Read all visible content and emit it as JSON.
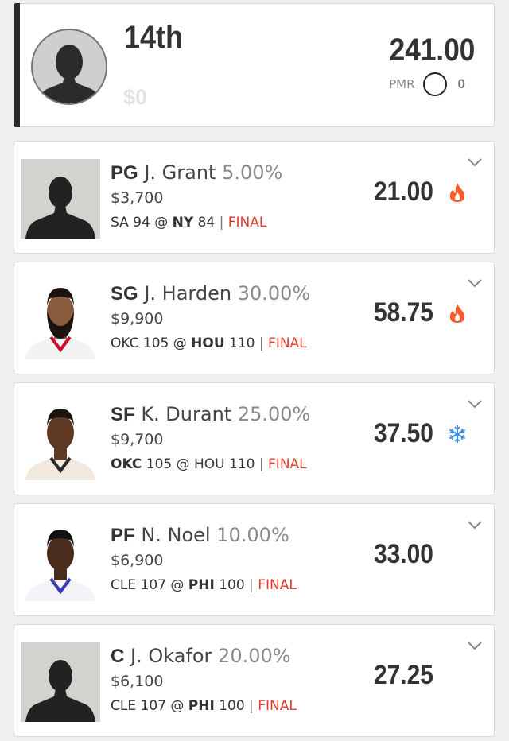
{
  "summary": {
    "rank": "14th",
    "winnings": "$0",
    "total_points": "241.00",
    "pmr_label": "PMR",
    "pmr_value": "0"
  },
  "players": [
    {
      "position": "PG",
      "name": "J. Grant",
      "ownership": "5.00%",
      "salary": "$3,700",
      "away_team": "SA",
      "away_score": "94",
      "home_team": "NY",
      "home_score": "84",
      "highlight": "home",
      "status": "FINAL",
      "fantasy_points": "21.00",
      "trend_icon": "fire-icon",
      "photo": "placeholder-silhouette"
    },
    {
      "position": "SG",
      "name": "J. Harden",
      "ownership": "30.00%",
      "salary": "$9,900",
      "away_team": "OKC",
      "away_score": "105",
      "home_team": "HOU",
      "home_score": "110",
      "highlight": "home",
      "status": "FINAL",
      "fantasy_points": "58.75",
      "trend_icon": "fire-icon",
      "photo": "player-headshot"
    },
    {
      "position": "SF",
      "name": "K. Durant",
      "ownership": "25.00%",
      "salary": "$9,700",
      "away_team": "OKC",
      "away_score": "105",
      "home_team": "HOU",
      "home_score": "110",
      "highlight": "away",
      "status": "FINAL",
      "fantasy_points": "37.50",
      "trend_icon": "snowflake-icon",
      "photo": "player-headshot"
    },
    {
      "position": "PF",
      "name": "N. Noel",
      "ownership": "10.00%",
      "salary": "$6,900",
      "away_team": "CLE",
      "away_score": "107",
      "home_team": "PHI",
      "home_score": "100",
      "highlight": "home",
      "status": "FINAL",
      "fantasy_points": "33.00",
      "trend_icon": "",
      "photo": "player-headshot"
    },
    {
      "position": "C",
      "name": "J. Okafor",
      "ownership": "20.00%",
      "salary": "$6,100",
      "away_team": "CLE",
      "away_score": "107",
      "home_team": "PHI",
      "home_score": "100",
      "highlight": "home",
      "status": "FINAL",
      "fantasy_points": "27.25",
      "trend_icon": "",
      "photo": "placeholder-silhouette"
    }
  ],
  "colors": {
    "final": "#e23b2a",
    "fire": "#ff5a2c",
    "snowflake": "#3a8de0",
    "accent_bar": "#2a2a2a"
  }
}
